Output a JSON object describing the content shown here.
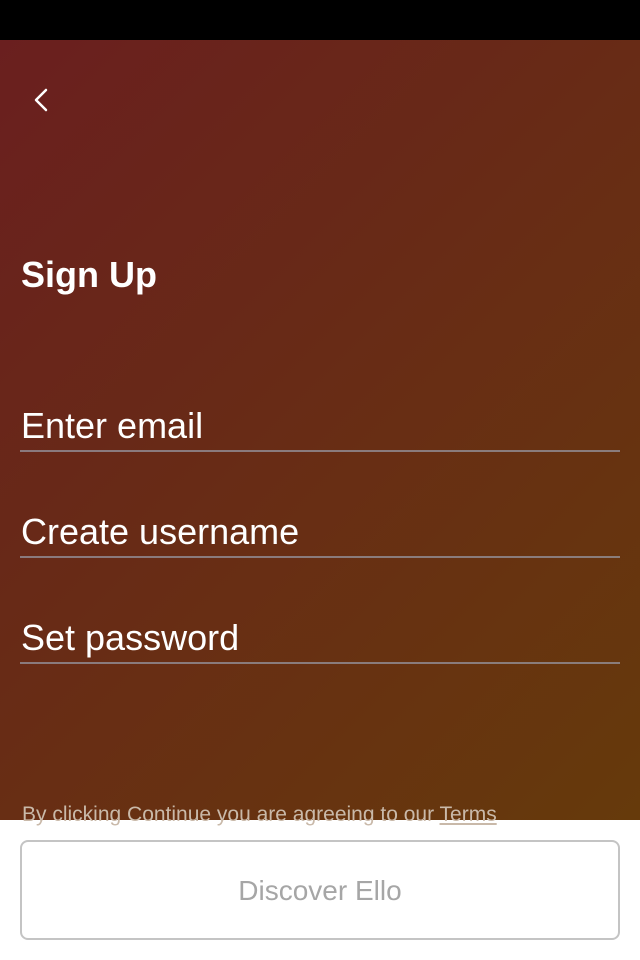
{
  "header": {
    "back_icon": "chevron-left-icon",
    "title": "Sign Up"
  },
  "form": {
    "email_placeholder": "Enter email",
    "username_placeholder": "Create username",
    "password_placeholder": "Set password"
  },
  "terms": {
    "text": "By clicking Continue you are agreeing to our ",
    "link_label": "Terms"
  },
  "footer": {
    "discover_label": "Discover Ello"
  },
  "colors": {
    "gradient_start": "#6a1f1f",
    "gradient_end": "#663a0b",
    "status_bar": "#000000",
    "button_border": "#c4c4c4",
    "button_text": "#a6a6a6"
  }
}
